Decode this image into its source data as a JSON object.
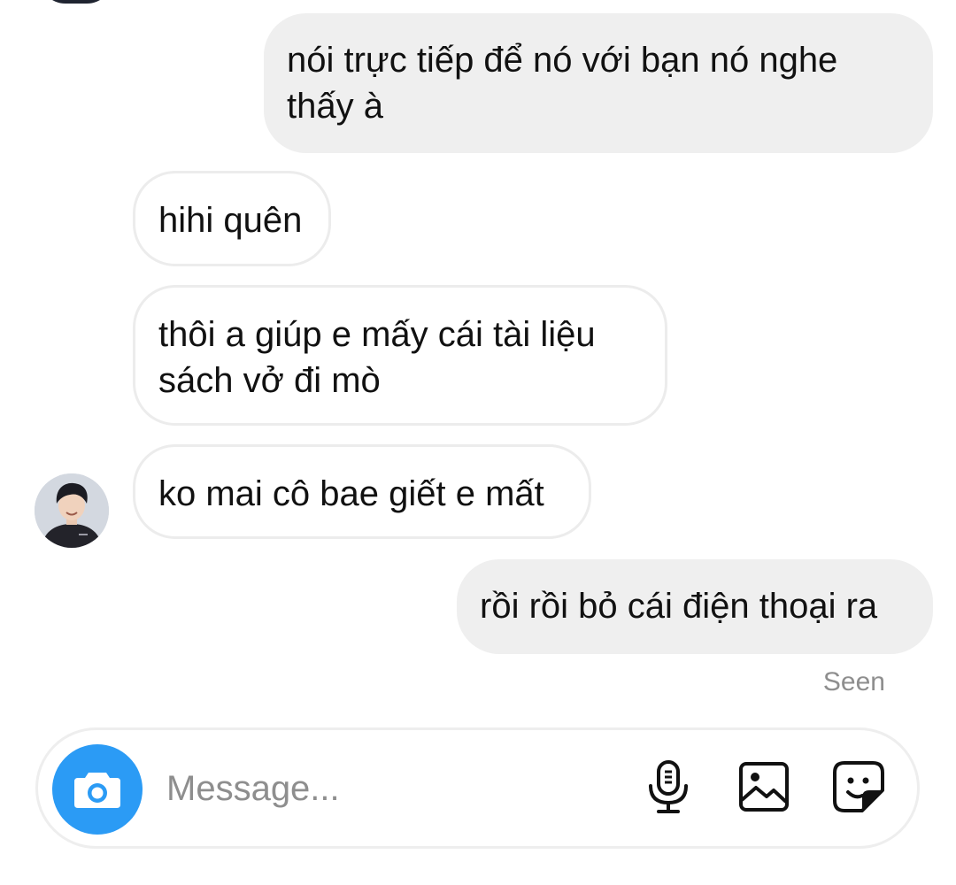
{
  "thread": {
    "messages": [
      {
        "direction": "outgoing",
        "lines": [
          "nói trực tiếp để nó với bạn nó nghe",
          "thấy à"
        ]
      },
      {
        "direction": "incoming",
        "lines": [
          "hihi quên"
        ]
      },
      {
        "direction": "incoming",
        "lines": [
          "thôi a giúp e mấy cái tài liệu",
          "sách vở đi mò"
        ]
      },
      {
        "direction": "incoming",
        "lines": [
          "ko mai cô bae giết e mất"
        ],
        "show_avatar": true
      },
      {
        "direction": "outgoing",
        "lines": [
          "rồi rồi bỏ cái điện thoại ra"
        ]
      }
    ],
    "seen_label": "Seen"
  },
  "composer": {
    "placeholder": "Message...",
    "value": "",
    "icons": [
      "camera-icon",
      "microphone-icon",
      "gallery-icon",
      "sticker-icon"
    ]
  },
  "colors": {
    "accent": "#2b9bf5",
    "outgoing_bubble": "#efefef",
    "incoming_border": "#ececec",
    "muted_text": "#8e8e8e"
  }
}
